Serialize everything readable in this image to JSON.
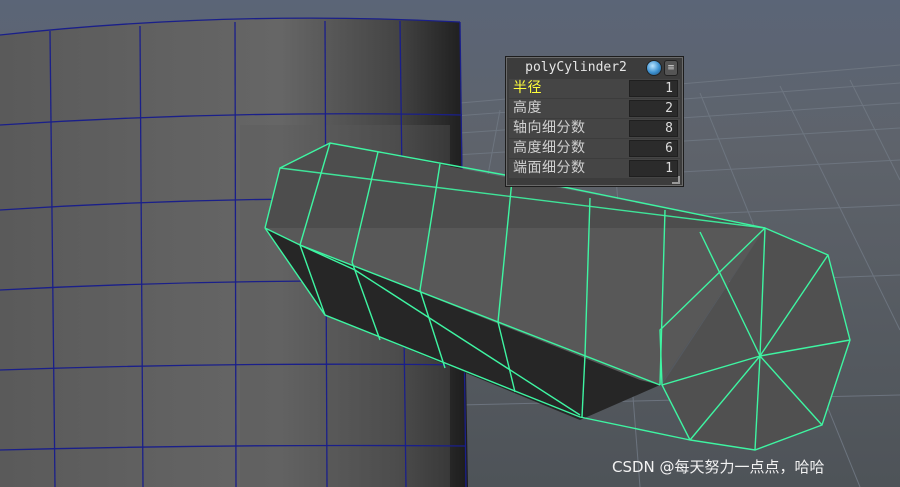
{
  "hud": {
    "title": "polyCylinder2",
    "rows": [
      {
        "label": "半径",
        "value": "1",
        "active": true
      },
      {
        "label": "高度",
        "value": "2",
        "active": false
      },
      {
        "label": "轴向细分数",
        "value": "8",
        "active": false
      },
      {
        "label": "高度细分数",
        "value": "6",
        "active": false
      },
      {
        "label": "端面细分数",
        "value": "1",
        "active": false
      }
    ]
  },
  "watermark": "CSDN @每天努力一点点，哈哈",
  "colors": {
    "background": "#5a6370",
    "grid": "#6b7480",
    "mesh_face": "#4f4f4f",
    "mesh_shadow": "#2a2a2a",
    "left_edge_wire": "#1a1f8a",
    "selected_wire": "#3ef5a2",
    "active_label": "#ffff3a"
  },
  "icons": [
    "globe-icon",
    "menu-icon",
    "resize-grip-icon"
  ]
}
